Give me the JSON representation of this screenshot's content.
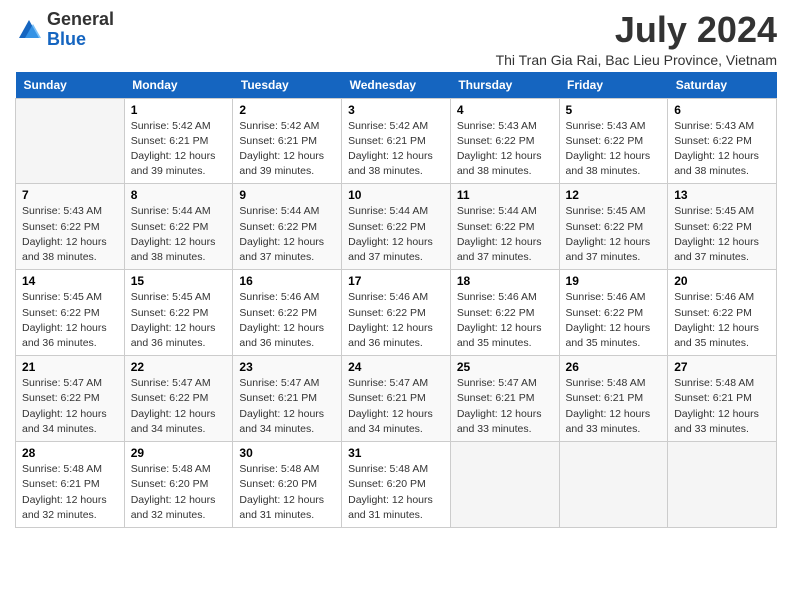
{
  "logo": {
    "general": "General",
    "blue": "Blue"
  },
  "title": "July 2024",
  "location": "Thi Tran Gia Rai, Bac Lieu Province, Vietnam",
  "days_of_week": [
    "Sunday",
    "Monday",
    "Tuesday",
    "Wednesday",
    "Thursday",
    "Friday",
    "Saturday"
  ],
  "weeks": [
    [
      {
        "day": "",
        "info": ""
      },
      {
        "day": "1",
        "info": "Sunrise: 5:42 AM\nSunset: 6:21 PM\nDaylight: 12 hours\nand 39 minutes."
      },
      {
        "day": "2",
        "info": "Sunrise: 5:42 AM\nSunset: 6:21 PM\nDaylight: 12 hours\nand 39 minutes."
      },
      {
        "day": "3",
        "info": "Sunrise: 5:42 AM\nSunset: 6:21 PM\nDaylight: 12 hours\nand 38 minutes."
      },
      {
        "day": "4",
        "info": "Sunrise: 5:43 AM\nSunset: 6:22 PM\nDaylight: 12 hours\nand 38 minutes."
      },
      {
        "day": "5",
        "info": "Sunrise: 5:43 AM\nSunset: 6:22 PM\nDaylight: 12 hours\nand 38 minutes."
      },
      {
        "day": "6",
        "info": "Sunrise: 5:43 AM\nSunset: 6:22 PM\nDaylight: 12 hours\nand 38 minutes."
      }
    ],
    [
      {
        "day": "7",
        "info": "Sunrise: 5:43 AM\nSunset: 6:22 PM\nDaylight: 12 hours\nand 38 minutes."
      },
      {
        "day": "8",
        "info": "Sunrise: 5:44 AM\nSunset: 6:22 PM\nDaylight: 12 hours\nand 38 minutes."
      },
      {
        "day": "9",
        "info": "Sunrise: 5:44 AM\nSunset: 6:22 PM\nDaylight: 12 hours\nand 37 minutes."
      },
      {
        "day": "10",
        "info": "Sunrise: 5:44 AM\nSunset: 6:22 PM\nDaylight: 12 hours\nand 37 minutes."
      },
      {
        "day": "11",
        "info": "Sunrise: 5:44 AM\nSunset: 6:22 PM\nDaylight: 12 hours\nand 37 minutes."
      },
      {
        "day": "12",
        "info": "Sunrise: 5:45 AM\nSunset: 6:22 PM\nDaylight: 12 hours\nand 37 minutes."
      },
      {
        "day": "13",
        "info": "Sunrise: 5:45 AM\nSunset: 6:22 PM\nDaylight: 12 hours\nand 37 minutes."
      }
    ],
    [
      {
        "day": "14",
        "info": "Sunrise: 5:45 AM\nSunset: 6:22 PM\nDaylight: 12 hours\nand 36 minutes."
      },
      {
        "day": "15",
        "info": "Sunrise: 5:45 AM\nSunset: 6:22 PM\nDaylight: 12 hours\nand 36 minutes."
      },
      {
        "day": "16",
        "info": "Sunrise: 5:46 AM\nSunset: 6:22 PM\nDaylight: 12 hours\nand 36 minutes."
      },
      {
        "day": "17",
        "info": "Sunrise: 5:46 AM\nSunset: 6:22 PM\nDaylight: 12 hours\nand 36 minutes."
      },
      {
        "day": "18",
        "info": "Sunrise: 5:46 AM\nSunset: 6:22 PM\nDaylight: 12 hours\nand 35 minutes."
      },
      {
        "day": "19",
        "info": "Sunrise: 5:46 AM\nSunset: 6:22 PM\nDaylight: 12 hours\nand 35 minutes."
      },
      {
        "day": "20",
        "info": "Sunrise: 5:46 AM\nSunset: 6:22 PM\nDaylight: 12 hours\nand 35 minutes."
      }
    ],
    [
      {
        "day": "21",
        "info": "Sunrise: 5:47 AM\nSunset: 6:22 PM\nDaylight: 12 hours\nand 34 minutes."
      },
      {
        "day": "22",
        "info": "Sunrise: 5:47 AM\nSunset: 6:22 PM\nDaylight: 12 hours\nand 34 minutes."
      },
      {
        "day": "23",
        "info": "Sunrise: 5:47 AM\nSunset: 6:21 PM\nDaylight: 12 hours\nand 34 minutes."
      },
      {
        "day": "24",
        "info": "Sunrise: 5:47 AM\nSunset: 6:21 PM\nDaylight: 12 hours\nand 34 minutes."
      },
      {
        "day": "25",
        "info": "Sunrise: 5:47 AM\nSunset: 6:21 PM\nDaylight: 12 hours\nand 33 minutes."
      },
      {
        "day": "26",
        "info": "Sunrise: 5:48 AM\nSunset: 6:21 PM\nDaylight: 12 hours\nand 33 minutes."
      },
      {
        "day": "27",
        "info": "Sunrise: 5:48 AM\nSunset: 6:21 PM\nDaylight: 12 hours\nand 33 minutes."
      }
    ],
    [
      {
        "day": "28",
        "info": "Sunrise: 5:48 AM\nSunset: 6:21 PM\nDaylight: 12 hours\nand 32 minutes."
      },
      {
        "day": "29",
        "info": "Sunrise: 5:48 AM\nSunset: 6:20 PM\nDaylight: 12 hours\nand 32 minutes."
      },
      {
        "day": "30",
        "info": "Sunrise: 5:48 AM\nSunset: 6:20 PM\nDaylight: 12 hours\nand 31 minutes."
      },
      {
        "day": "31",
        "info": "Sunrise: 5:48 AM\nSunset: 6:20 PM\nDaylight: 12 hours\nand 31 minutes."
      },
      {
        "day": "",
        "info": ""
      },
      {
        "day": "",
        "info": ""
      },
      {
        "day": "",
        "info": ""
      }
    ]
  ]
}
